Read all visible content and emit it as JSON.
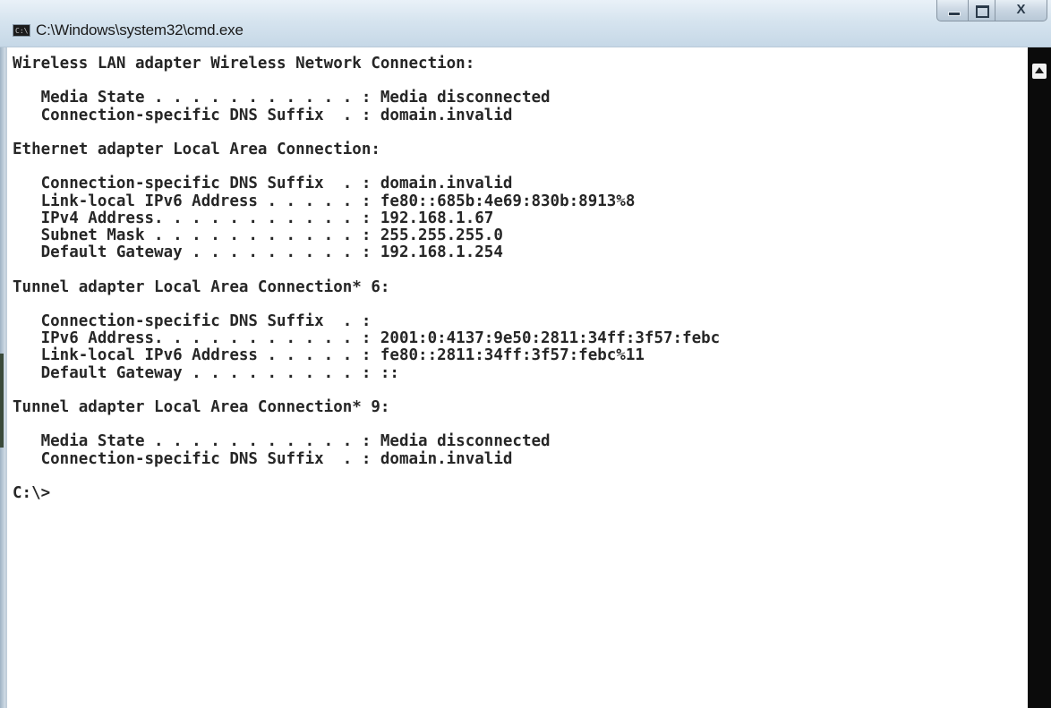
{
  "window": {
    "title": "C:\\Windows\\system32\\cmd.exe",
    "title_icon_text": "C:\\"
  },
  "caption": {
    "close_label": "X"
  },
  "console": {
    "lines": [
      "Wireless LAN adapter Wireless Network Connection:",
      "",
      "   Media State . . . . . . . . . . . : Media disconnected",
      "   Connection-specific DNS Suffix  . : domain.invalid",
      "",
      "Ethernet adapter Local Area Connection:",
      "",
      "   Connection-specific DNS Suffix  . : domain.invalid",
      "   Link-local IPv6 Address . . . . . : fe80::685b:4e69:830b:8913%8",
      "   IPv4 Address. . . . . . . . . . . : 192.168.1.67",
      "   Subnet Mask . . . . . . . . . . . : 255.255.255.0",
      "   Default Gateway . . . . . . . . . : 192.168.1.254",
      "",
      "Tunnel adapter Local Area Connection* 6:",
      "",
      "   Connection-specific DNS Suffix  . :",
      "   IPv6 Address. . . . . . . . . . . : 2001:0:4137:9e50:2811:34ff:3f57:febc",
      "   Link-local IPv6 Address . . . . . : fe80::2811:34ff:3f57:febc%11",
      "   Default Gateway . . . . . . . . . : ::",
      "",
      "Tunnel adapter Local Area Connection* 9:",
      "",
      "   Media State . . . . . . . . . . . : Media disconnected",
      "   Connection-specific DNS Suffix  . : domain.invalid",
      "",
      "C:\\>"
    ]
  },
  "colors": {
    "console_background": "#ffffff",
    "console_text": "#262626",
    "titlebar": "#d6e4ef",
    "scrollbar": "#0b0b0b"
  },
  "icons": {
    "title_icon": "console-app-icon",
    "minimize": "minimize-icon",
    "maximize": "maximize-icon",
    "close": "close-icon",
    "scroll_up": "scroll-up-arrow-icon"
  }
}
